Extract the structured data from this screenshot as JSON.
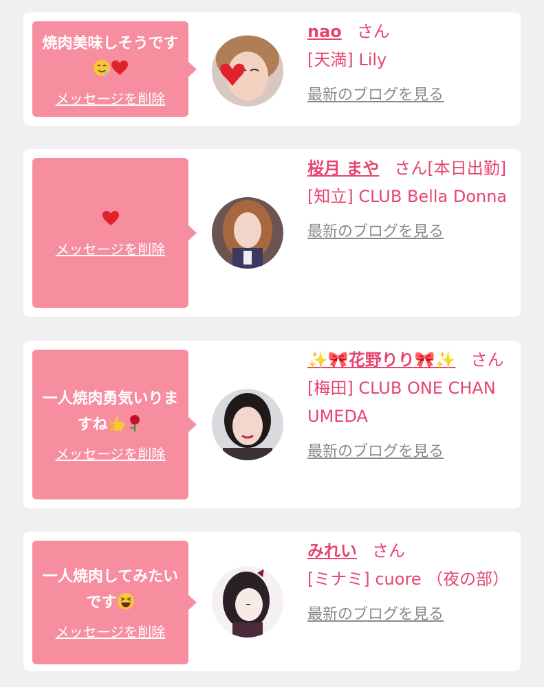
{
  "delete_label": "メッセージを削除",
  "blog_label": "最新のブログを見る",
  "honorific": "さん",
  "colors": {
    "background": "#f0f0f0",
    "bubble": "#f68ea0",
    "accent": "#e6456e",
    "link_gray": "#8a8a8a"
  },
  "messages": [
    {
      "text": "焼肉美味しそうです",
      "emoji": [
        "drooling-face",
        "red-heart"
      ],
      "name": "nao",
      "suffix": "",
      "shop": "[天満] Lily"
    },
    {
      "text": "",
      "emoji": [
        "red-heart"
      ],
      "name": "桜月 まや",
      "suffix": "[本日出勤]",
      "shop": "[知立] CLUB Bella Donna"
    },
    {
      "text": "一人焼肉勇気いりますね",
      "emoji": [
        "thumbs-up",
        "rose"
      ],
      "name": "✨🎀花野りり🎀✨",
      "suffix": "",
      "shop": "[梅田] CLUB ONE CHAN UMEDA"
    },
    {
      "text": "一人焼肉してみたいです",
      "emoji": [
        "grinning-squinting-face"
      ],
      "name": "みれい",
      "suffix": "",
      "shop": "[ミナミ] cuore （夜の部）"
    }
  ]
}
